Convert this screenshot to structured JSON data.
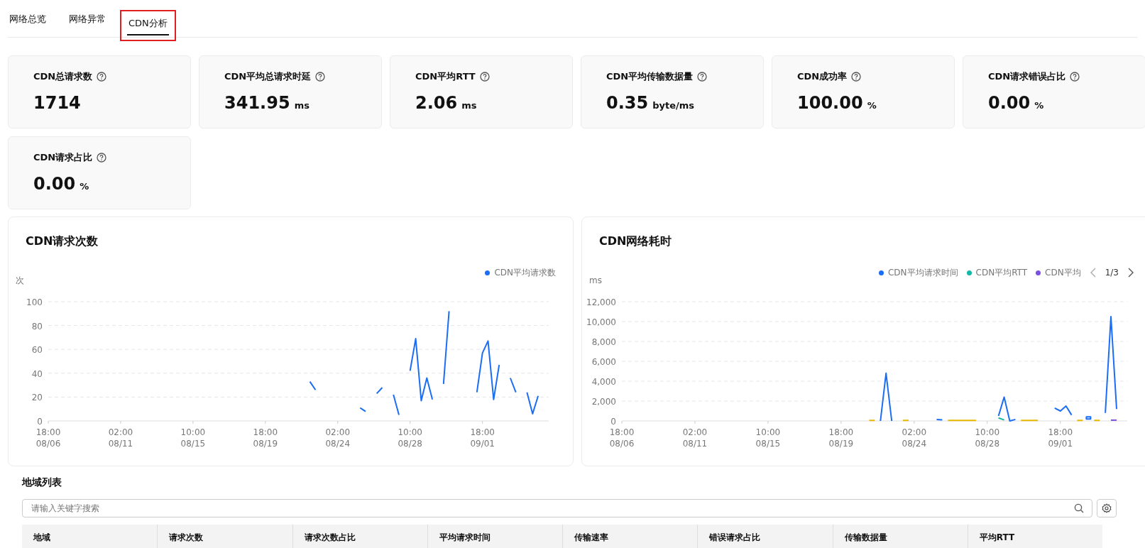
{
  "tabs": [
    {
      "label": "网络总览",
      "selected": false,
      "highlighted": false
    },
    {
      "label": "网络异常",
      "selected": false,
      "highlighted": false
    },
    {
      "label": "CDN分析",
      "selected": true,
      "highlighted": true
    }
  ],
  "metrics": [
    {
      "label": "CDN总请求数",
      "value": "1714"
    },
    {
      "label": "CDN平均总请求时延",
      "value": "341.95",
      "unit": "ms"
    },
    {
      "label": "CDN平均RTT",
      "value": "2.06",
      "unit": "ms"
    },
    {
      "label": "CDN平均传输数据量",
      "value": "0.35",
      "unit": "byte/ms"
    },
    {
      "label": "CDN成功率",
      "value": "100.00",
      "unit": "%"
    },
    {
      "label": "CDN请求错误占比",
      "value": "0.00",
      "unit": "%"
    },
    {
      "label": "CDN请求占比",
      "value": "0.00",
      "unit": "%"
    }
  ],
  "charts": [
    {
      "title": "CDN请求次数",
      "chart_data": {
        "type": "line",
        "grid": true,
        "ylabel": "次",
        "ylim": [
          0,
          100
        ],
        "yticks": [
          0,
          20,
          40,
          60,
          80,
          100
        ],
        "categories": [
          "18:00 08/06",
          null,
          null,
          null,
          null,
          null,
          null,
          null,
          null,
          null,
          null,
          null,
          null,
          "02:00 08/11",
          null,
          null,
          null,
          null,
          null,
          null,
          null,
          null,
          null,
          null,
          null,
          null,
          "10:00 08/15",
          null,
          null,
          null,
          null,
          null,
          null,
          null,
          null,
          null,
          null,
          null,
          null,
          "18:00 08/19",
          null,
          null,
          null,
          null,
          null,
          null,
          null,
          null,
          null,
          null,
          null,
          null,
          "02:00 08/24",
          null,
          null,
          null,
          null,
          null,
          null,
          null,
          null,
          null,
          null,
          null,
          null,
          "10:00 08/28",
          null,
          null,
          null,
          null,
          null,
          null,
          null,
          null,
          null,
          null,
          null,
          null,
          "18:00 09/01",
          null,
          null,
          null,
          null,
          null,
          null,
          null,
          null,
          null,
          null,
          null
        ],
        "series": [
          {
            "name": "CDN平均请求数",
            "color": "#1b6ef3",
            "values": [
              null,
              null,
              null,
              null,
              null,
              null,
              null,
              null,
              null,
              null,
              null,
              null,
              null,
              null,
              null,
              null,
              null,
              null,
              null,
              null,
              null,
              null,
              null,
              null,
              null,
              null,
              null,
              null,
              null,
              null,
              null,
              null,
              null,
              null,
              null,
              null,
              null,
              null,
              null,
              null,
              null,
              null,
              null,
              null,
              null,
              null,
              null,
              33,
              26,
              null,
              null,
              null,
              null,
              null,
              null,
              null,
              11,
              8,
              null,
              23,
              28,
              null,
              22,
              5,
              null,
              42,
              69,
              17,
              36,
              18,
              null,
              31,
              92,
              null,
              null,
              null,
              null,
              24,
              57,
              67,
              18,
              47,
              null,
              36,
              24,
              null,
              24,
              6,
              21,
              null
            ]
          }
        ]
      }
    },
    {
      "title": "CDN网络耗时",
      "legend_pager": "1/3",
      "chart_data": {
        "type": "line",
        "grid": true,
        "ylabel": "ms",
        "ylim": [
          0,
          12000
        ],
        "yticks": [
          {
            "value": 0,
            "label": "0"
          },
          {
            "value": 2000,
            "label": "2,000"
          },
          {
            "value": 4000,
            "label": "4,000"
          },
          {
            "value": 6000,
            "label": "6,000"
          },
          {
            "value": 8000,
            "label": "8,000"
          },
          {
            "value": 10000,
            "label": "10,000"
          },
          {
            "value": 12000,
            "label": "12,000"
          }
        ],
        "categories": [
          "18:00 08/06",
          null,
          null,
          null,
          null,
          null,
          null,
          null,
          null,
          null,
          null,
          null,
          null,
          "02:00 08/11",
          null,
          null,
          null,
          null,
          null,
          null,
          null,
          null,
          null,
          null,
          null,
          null,
          "10:00 08/15",
          null,
          null,
          null,
          null,
          null,
          null,
          null,
          null,
          null,
          null,
          null,
          null,
          "18:00 08/19",
          null,
          null,
          null,
          null,
          null,
          null,
          null,
          null,
          null,
          null,
          null,
          null,
          "02:00 08/24",
          null,
          null,
          null,
          null,
          null,
          null,
          null,
          null,
          null,
          null,
          null,
          null,
          "10:00 08/28",
          null,
          null,
          null,
          null,
          null,
          null,
          null,
          null,
          null,
          null,
          null,
          null,
          "18:00 09/01",
          null,
          null,
          null,
          null,
          null,
          null,
          null,
          null,
          null,
          null,
          null
        ],
        "series": [
          {
            "name": "CDN平均请求时间",
            "color": "#1b6ef3",
            "values": [
              null,
              null,
              null,
              null,
              null,
              null,
              null,
              null,
              null,
              null,
              null,
              null,
              null,
              null,
              null,
              null,
              null,
              null,
              null,
              null,
              null,
              null,
              null,
              null,
              null,
              null,
              null,
              null,
              null,
              null,
              null,
              null,
              null,
              null,
              null,
              null,
              null,
              null,
              null,
              null,
              null,
              null,
              null,
              null,
              null,
              null,
              0,
              4800,
              0,
              null,
              null,
              null,
              null,
              null,
              null,
              null,
              150,
              100,
              null,
              null,
              null,
              null,
              null,
              null,
              null,
              null,
              null,
              500,
              2400,
              0,
              150,
              null,
              null,
              null,
              null,
              null,
              null,
              1300,
              1000,
              1500,
              600,
              null,
              null,
              300,
              null,
              null,
              800,
              10500,
              1200,
              null
            ]
          },
          {
            "name": "CDN平均RTT",
            "color": "#14b8a6",
            "values": [
              null,
              null,
              null,
              null,
              null,
              null,
              null,
              null,
              null,
              null,
              null,
              null,
              null,
              null,
              null,
              null,
              null,
              null,
              null,
              null,
              null,
              null,
              null,
              null,
              null,
              null,
              null,
              null,
              null,
              null,
              null,
              null,
              null,
              null,
              null,
              null,
              null,
              null,
              null,
              null,
              null,
              null,
              null,
              null,
              null,
              null,
              null,
              null,
              null,
              null,
              null,
              null,
              null,
              null,
              null,
              null,
              null,
              null,
              null,
              null,
              null,
              null,
              null,
              null,
              null,
              null,
              null,
              300,
              100,
              null,
              null,
              null,
              null,
              null,
              null,
              null,
              null,
              null,
              null,
              null,
              null,
              null,
              null,
              null,
              null,
              null,
              null,
              null,
              null,
              null
            ]
          },
          {
            "name": "CDN平均",
            "color": "#7b4fe0",
            "values": [
              null,
              null,
              null,
              null,
              null,
              null,
              null,
              null,
              null,
              null,
              null,
              null,
              null,
              null,
              null,
              null,
              null,
              null,
              null,
              null,
              null,
              null,
              null,
              null,
              null,
              null,
              null,
              null,
              null,
              null,
              null,
              null,
              null,
              null,
              null,
              null,
              null,
              null,
              null,
              null,
              null,
              null,
              null,
              null,
              null,
              null,
              null,
              null,
              null,
              null,
              null,
              null,
              null,
              null,
              null,
              null,
              null,
              null,
              null,
              null,
              null,
              null,
              null,
              null,
              null,
              null,
              null,
              null,
              null,
              null,
              null,
              null,
              null,
              null,
              null,
              null,
              null,
              null,
              null,
              null,
              null,
              null,
              null,
              null,
              null,
              null,
              null,
              80,
              80,
              null
            ]
          },
          {
            "color": "#e6b800",
            "values": [
              null,
              null,
              null,
              null,
              null,
              null,
              null,
              null,
              null,
              null,
              null,
              null,
              null,
              null,
              null,
              null,
              null,
              null,
              null,
              null,
              null,
              null,
              null,
              null,
              null,
              null,
              null,
              null,
              null,
              null,
              null,
              null,
              null,
              null,
              null,
              null,
              null,
              null,
              null,
              null,
              null,
              null,
              null,
              null,
              60,
              60,
              null,
              null,
              null,
              null,
              60,
              60,
              null,
              null,
              null,
              null,
              null,
              null,
              60,
              60,
              60,
              60,
              60,
              60,
              null,
              null,
              null,
              null,
              null,
              null,
              null,
              60,
              60,
              60,
              60,
              null,
              null,
              null,
              null,
              null,
              null,
              60,
              60,
              null,
              60,
              60,
              null,
              null,
              null,
              null
            ]
          }
        ]
      }
    }
  ],
  "region": {
    "title": "地域列表",
    "search": {
      "placeholder": "请输入关键字搜索"
    },
    "columns": [
      "地域",
      "请求次数",
      "请求次数占比",
      "平均请求时间",
      "传输速率",
      "错误请求占比",
      "传输数据量",
      "平均RTT"
    ]
  }
}
